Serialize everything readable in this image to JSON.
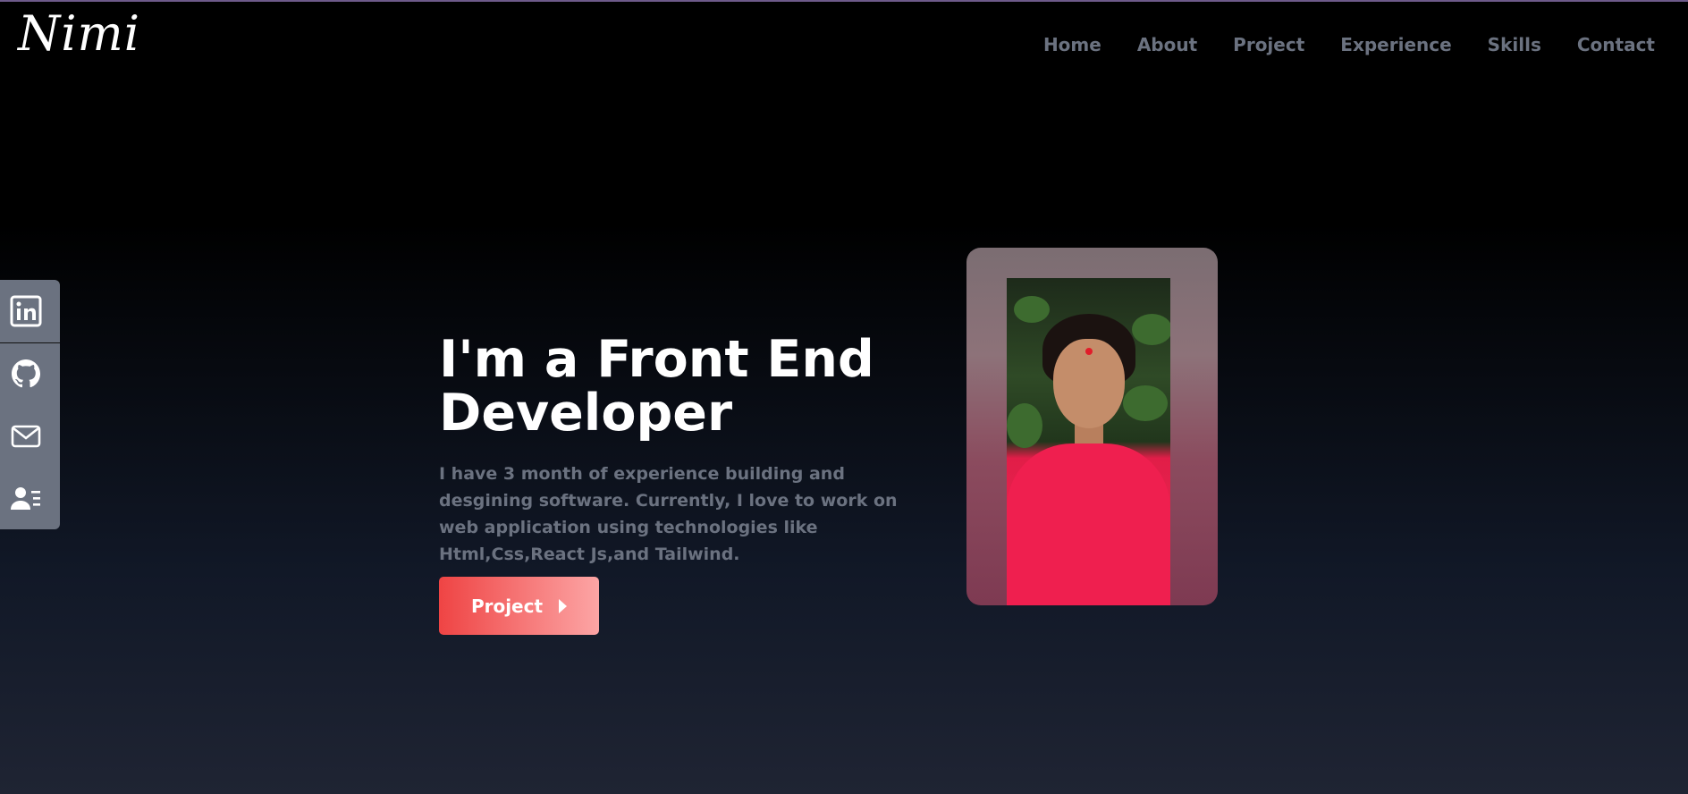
{
  "brand": {
    "logo": "Nimi"
  },
  "nav": {
    "items": [
      {
        "label": "Home"
      },
      {
        "label": "About"
      },
      {
        "label": "Project"
      },
      {
        "label": "Experience"
      },
      {
        "label": "Skills"
      },
      {
        "label": "Contact"
      }
    ]
  },
  "social": {
    "items": [
      {
        "icon": "linkedin-icon"
      },
      {
        "icon": "github-icon"
      },
      {
        "icon": "mail-icon"
      },
      {
        "icon": "resume-icon"
      }
    ]
  },
  "hero": {
    "title_line1": "I'm a Front End",
    "title_line2": "Developer",
    "description": "I have 3 month of experience building and desgining software. Currently, I love to work on web application using technologies like Html,Css,React Js,and Tailwind.",
    "button_label": "Project"
  },
  "colors": {
    "nav_text": "#6b7280",
    "button_gradient_start": "#ef4444",
    "button_gradient_end": "#fca5a5",
    "sidebar_bg": "#6b7280"
  }
}
